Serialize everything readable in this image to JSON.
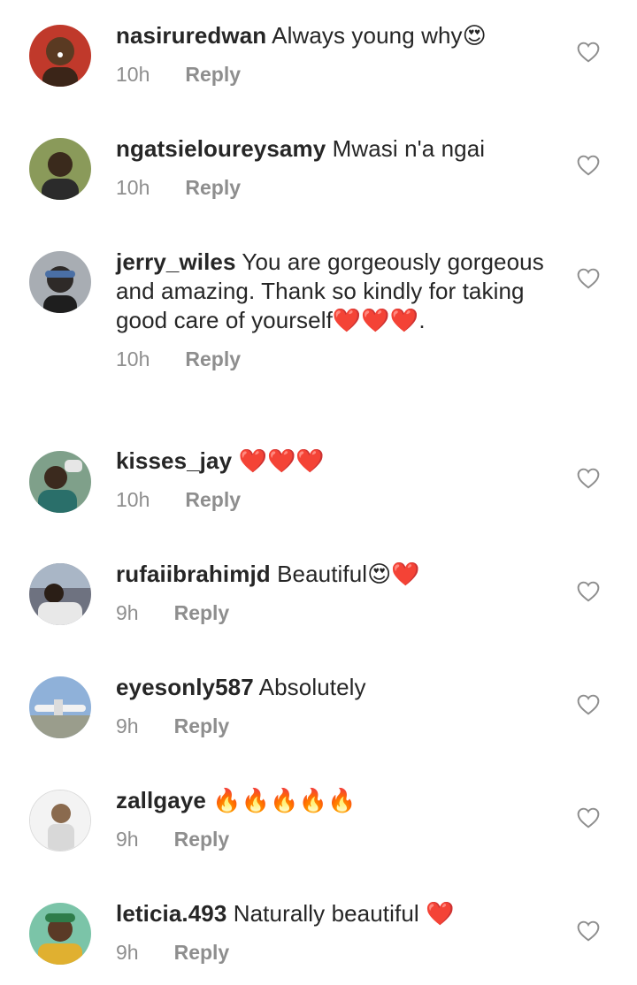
{
  "comments": [
    {
      "username": "nasiruredwan",
      "text": "Always young why😍",
      "time": "10h",
      "reply": "Reply",
      "avatar_color": "#c0392b"
    },
    {
      "username": "ngatsieloureysamy",
      "text": "Mwasi n'a ngai",
      "time": "10h",
      "reply": "Reply",
      "avatar_color": "#7a8a4a"
    },
    {
      "username": "jerry_wiles",
      "text": "You are gorgeously gorgeous and amazing. Thank so kindly for taking good care of yourself❤️❤️❤️.",
      "time": "10h",
      "reply": "Reply",
      "avatar_color": "#9aa0a6"
    },
    {
      "username": "kisses_jay",
      "text": "❤️❤️❤️",
      "time": "10h",
      "reply": "Reply",
      "avatar_color": "#5f7d6a"
    },
    {
      "username": "rufaiibrahimjd",
      "text": "Beautiful😍❤️",
      "time": "9h",
      "reply": "Reply",
      "avatar_color": "#6b6b70"
    },
    {
      "username": "eyesonly587",
      "text": "Absolutely",
      "time": "9h",
      "reply": "Reply",
      "avatar_color": "#8fb1d9"
    },
    {
      "username": "zallgaye",
      "text": "🔥🔥🔥🔥🔥",
      "time": "9h",
      "reply": "Reply",
      "avatar_color": "#e8e8e8"
    },
    {
      "username": "leticia.493",
      "text": "Naturally beautiful ❤️",
      "time": "9h",
      "reply": "Reply",
      "avatar_color": "#d9a93a"
    }
  ],
  "icons": {
    "like": "heart-outline-icon"
  }
}
